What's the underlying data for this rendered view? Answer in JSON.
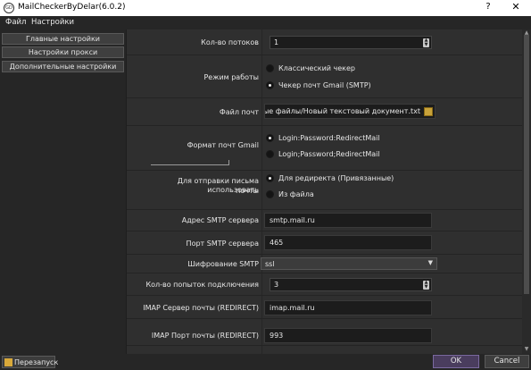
{
  "window": {
    "title": "MailCheckerByDelar(6.0.2)",
    "app_icon_text": "GD",
    "help": "?",
    "close": "✕"
  },
  "menu": {
    "file": "Файл",
    "settings": "Настройки"
  },
  "sidebar": {
    "items": [
      {
        "label": "Главные настройки"
      },
      {
        "label": "Настройки прокси"
      },
      {
        "label": "Дополнительные настройки"
      }
    ]
  },
  "form": {
    "threads": {
      "label": "Кол-во потоков",
      "value": "1"
    },
    "mode": {
      "label": "Режим работы",
      "options": [
        {
          "label": "Классический чекер",
          "checked": false
        },
        {
          "label": "Чекер почт Gmail (SMTP)",
          "checked": true
        }
      ]
    },
    "mail_file": {
      "label": "Файл почт",
      "value": "ые файлы/Новый текстовый документ.txt"
    },
    "gmail_format": {
      "label": "Формат почт Gmail",
      "options": [
        {
          "label": "Login:Password:RedirectMail",
          "checked": true
        },
        {
          "label": "Login;Password;RedirectMail",
          "checked": false
        }
      ]
    },
    "send_for": {
      "label_line1": "Для отправки письма использовать",
      "label_line2": "почты",
      "options": [
        {
          "label": "Для редиректа (Привязанные)",
          "checked": true
        },
        {
          "label": "Из файла",
          "checked": false
        }
      ]
    },
    "smtp_server": {
      "label": "Адрес SMTP сервера",
      "value": "smtp.mail.ru"
    },
    "smtp_port": {
      "label": "Порт SMTP сервера",
      "value": "465"
    },
    "smtp_encryption": {
      "label": "Шифрование SMTP",
      "value": "ssl"
    },
    "connect_attempts": {
      "label": "Кол-во попыток подключения",
      "value": "3"
    },
    "imap_server": {
      "label": "IMAP Сервер почты (REDIRECT)",
      "value": "imap.mail.ru"
    },
    "imap_port": {
      "label": "IMAP Порт почты (REDIRECT)",
      "value": "993"
    }
  },
  "footer": {
    "restart": "Перезапуск",
    "ok": "OK",
    "cancel": "Cancel"
  }
}
